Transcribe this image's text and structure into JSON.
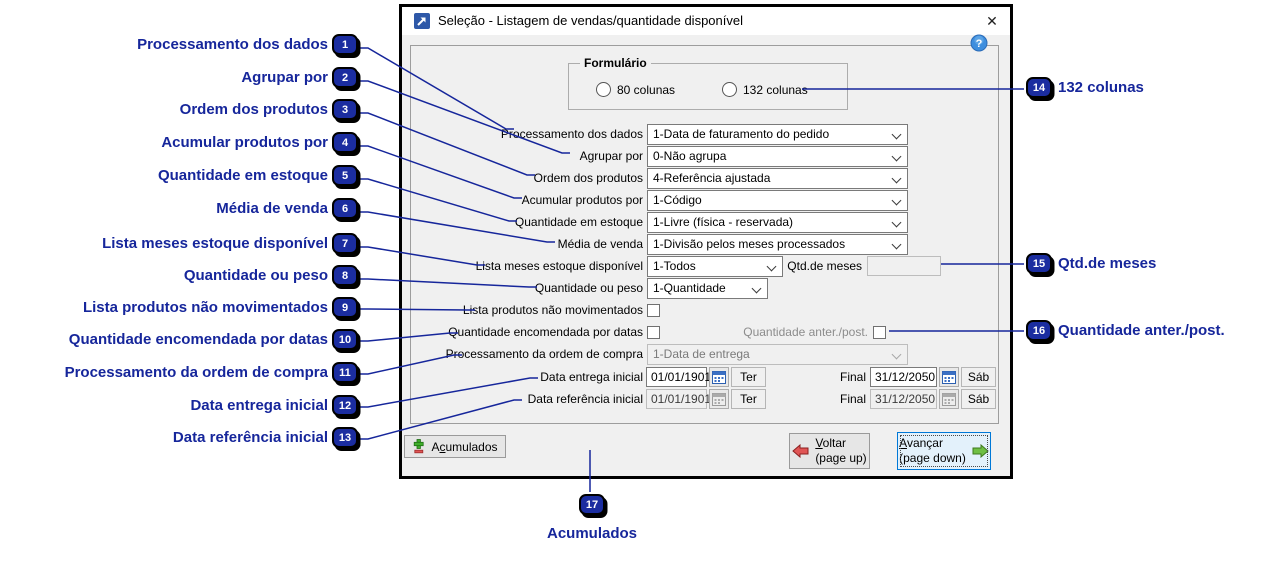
{
  "annotations": {
    "left": [
      {
        "num": "1",
        "label": "Processamento dos dados"
      },
      {
        "num": "2",
        "label": "Agrupar por"
      },
      {
        "num": "3",
        "label": "Ordem dos produtos"
      },
      {
        "num": "4",
        "label": "Acumular produtos por"
      },
      {
        "num": "5",
        "label": "Quantidade em estoque"
      },
      {
        "num": "6",
        "label": "Média de venda"
      },
      {
        "num": "7",
        "label": "Lista meses estoque disponível"
      },
      {
        "num": "8",
        "label": "Quantidade ou peso"
      },
      {
        "num": "9",
        "label": "Lista produtos não movimentados"
      },
      {
        "num": "10",
        "label": "Quantidade encomendada por datas"
      },
      {
        "num": "11",
        "label": "Processamento da ordem de compra"
      },
      {
        "num": "12",
        "label": "Data entrega inicial"
      },
      {
        "num": "13",
        "label": "Data referência inicial"
      }
    ],
    "right": [
      {
        "num": "14",
        "label": "132 colunas"
      },
      {
        "num": "15",
        "label": "Qtd.de meses"
      },
      {
        "num": "16",
        "label": "Quantidade anter./post."
      }
    ],
    "bottom": {
      "num": "17",
      "label": "Acumulados"
    }
  },
  "dialog": {
    "title": "Seleção - Listagem de vendas/quantidade disponível",
    "close_glyph": "✕",
    "help_glyph": "?",
    "formulario": {
      "legend": "Formulário",
      "radio_80": "80 colunas",
      "radio_132": "132 colunas"
    },
    "fields": {
      "processamento": {
        "label": "Processamento dos dados",
        "value": "1-Data de faturamento do pedido"
      },
      "agrupar": {
        "label": "Agrupar por",
        "value": "0-Não agrupa"
      },
      "ordem": {
        "label": "Ordem dos produtos",
        "value": "4-Referência ajustada"
      },
      "acumular": {
        "label": "Acumular produtos por",
        "value": "1-Código"
      },
      "estoque": {
        "label": "Quantidade em estoque",
        "value": "1-Livre (física - reservada)"
      },
      "media": {
        "label": "Média de venda",
        "value": "1-Divisão pelos meses processados"
      },
      "meses": {
        "label": "Lista meses estoque disponível",
        "value": "1-Todos",
        "qtd_label": "Qtd.de meses",
        "qtd_value": ""
      },
      "peso": {
        "label": "Quantidade ou peso",
        "value": "1-Quantidade"
      },
      "nao_movimentados": {
        "label": "Lista produtos não movimentados"
      },
      "encomendada": {
        "label": "Quantidade encomendada por datas",
        "anter_label": "Quantidade anter./post."
      },
      "ordem_compra": {
        "label": "Processamento da ordem de compra",
        "value": "1-Data de entrega"
      },
      "data_entrega": {
        "label": "Data entrega inicial",
        "value": "01/01/1901",
        "day": "Ter",
        "final_label": "Final",
        "final_value": "31/12/2050",
        "final_day": "Sáb"
      },
      "data_referencia": {
        "label": "Data referência inicial",
        "value": "01/01/1901",
        "day": "Ter",
        "final_label": "Final",
        "final_value": "31/12/2050",
        "final_day": "Sáb"
      }
    },
    "buttons": {
      "acumulados": {
        "pre": "A",
        "underline": "c",
        "post": "umulados"
      },
      "voltar": {
        "underline": "V",
        "post": "oltar",
        "sub": "(page up)"
      },
      "avancar": {
        "underline": "A",
        "post": "vançar",
        "sub": "(page down)"
      }
    }
  },
  "colors": {
    "annotation": "#16269B",
    "badge": "#1B2DA0",
    "focus_border": "#0078D7"
  }
}
